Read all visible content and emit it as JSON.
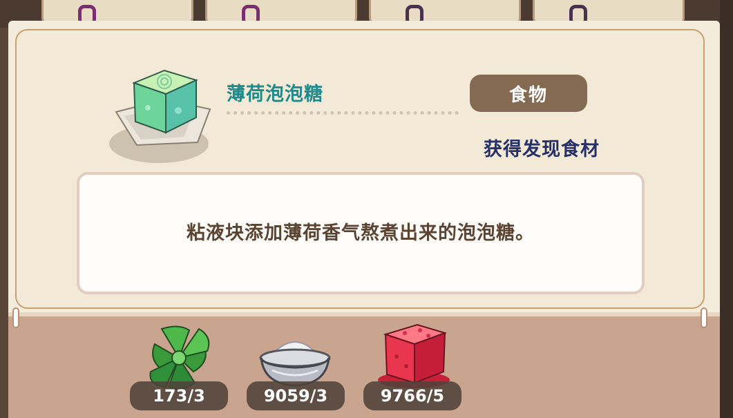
{
  "item": {
    "name": "薄荷泡泡糖",
    "category": "食物",
    "status": "获得发现食材",
    "description": "粘液块添加薄荷香气熬煮出来的泡泡糖。",
    "icon": "mint-bubblegum-cube-icon"
  },
  "ingredients": [
    {
      "icon": "mint-leaves-icon",
      "count": "173/3"
    },
    {
      "icon": "salt-bowl-icon",
      "count": "9059/3"
    },
    {
      "icon": "red-slime-cube-icon",
      "count": "9766/5"
    }
  ],
  "background_cards": [
    "card-1",
    "card-2",
    "card-3",
    "card-4"
  ],
  "colors": {
    "title": "#1f8a8c",
    "badge": "#856a52",
    "status": "#25306a",
    "tray": "#c9a48e"
  }
}
